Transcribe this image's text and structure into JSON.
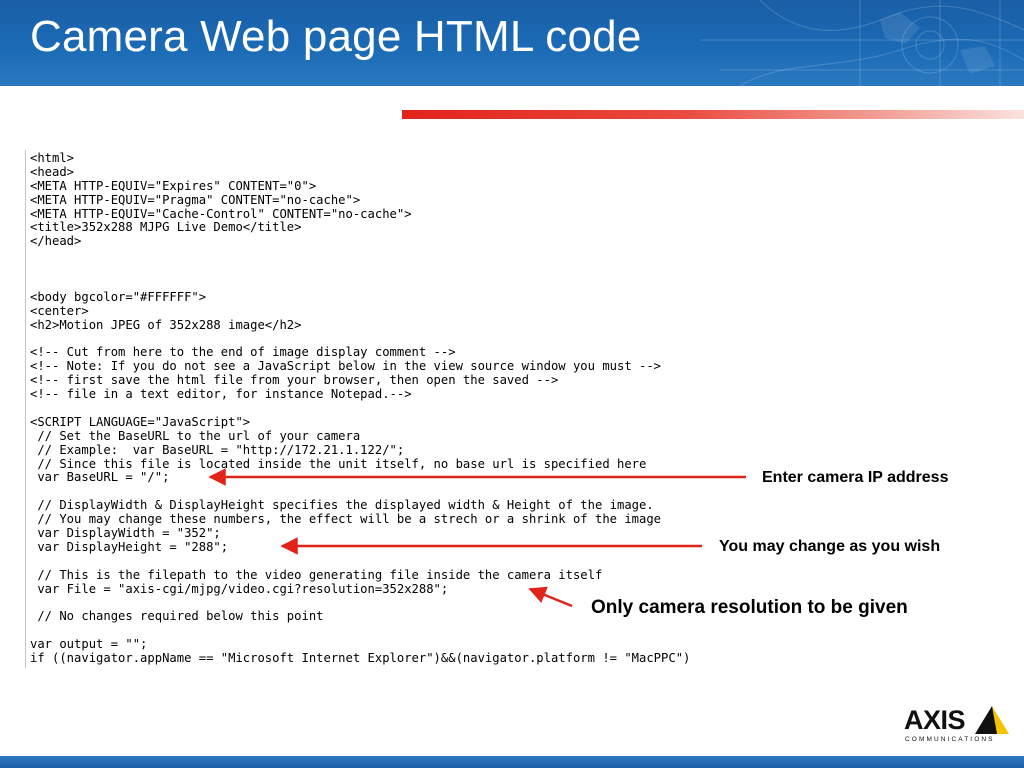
{
  "slide": {
    "title": "Camera Web page HTML code"
  },
  "code_lines": [
    "<html>",
    "<head>",
    "<META HTTP-EQUIV=\"Expires\" CONTENT=\"0\">",
    "<META HTTP-EQUIV=\"Pragma\" CONTENT=\"no-cache\">",
    "<META HTTP-EQUIV=\"Cache-Control\" CONTENT=\"no-cache\">",
    "<title>352x288 MJPG Live Demo</title>",
    "</head>",
    "",
    "",
    "",
    "<body bgcolor=\"#FFFFFF\">",
    "<center>",
    "<h2>Motion JPEG of 352x288 image</h2>",
    "",
    "<!-- Cut from here to the end of image display comment -->",
    "<!-- Note: If you do not see a JavaScript below in the view source window you must -->",
    "<!-- first save the html file from your browser, then open the saved -->",
    "<!-- file in a text editor, for instance Notepad.-->",
    "",
    "<SCRIPT LANGUAGE=\"JavaScript\">",
    " // Set the BaseURL to the url of your camera",
    " // Example:  var BaseURL = \"http://172.21.1.122/\";",
    " // Since this file is located inside the unit itself, no base url is specified here",
    " var BaseURL = \"/\";",
    "",
    " // DisplayWidth & DisplayHeight specifies the displayed width & Height of the image.",
    " // You may change these numbers, the effect will be a strech or a shrink of the image",
    " var DisplayWidth = \"352\";",
    " var DisplayHeight = \"288\";",
    "",
    " // This is the filepath to the video generating file inside the camera itself",
    " var File = \"axis-cgi/mjpg/video.cgi?resolution=352x288\";",
    "",
    " // No changes required below this point",
    "",
    "var output = \"\";",
    "if ((navigator.appName == \"Microsoft Internet Explorer\")&&(navigator.platform != \"MacPPC\")"
  ],
  "annotations": {
    "ip": "Enter camera IP address",
    "size": "You may change as you wish",
    "resolution": "Only camera resolution to be given"
  },
  "logo": {
    "name": "AXIS",
    "tagline": "COMMUNICATIONS"
  },
  "colors": {
    "header_blue": "#1b6ab5",
    "accent_red": "#e2231a",
    "arrow_red": "#e2231a",
    "logo_yellow": "#f5c400"
  }
}
